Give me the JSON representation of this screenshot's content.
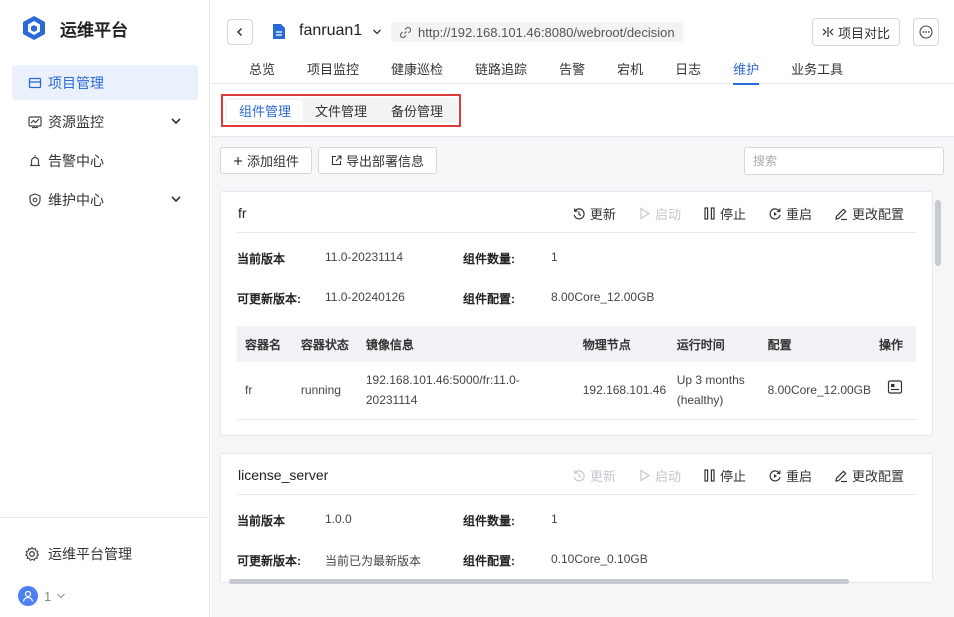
{
  "app": {
    "title": "运维平台",
    "brand_color": "#2a6ad6"
  },
  "sidebar": {
    "items": [
      {
        "label": "项目管理",
        "icon": "folder-icon",
        "active": true
      },
      {
        "label": "资源监控",
        "icon": "monitor-icon",
        "expandable": true
      },
      {
        "label": "告警中心",
        "icon": "alarm-icon"
      },
      {
        "label": "维护中心",
        "icon": "shield-icon",
        "expandable": true
      }
    ],
    "manage_label": "运维平台管理",
    "user_label": "1"
  },
  "header": {
    "project_name": "fanruan1",
    "url": "http://192.168.101.46:8080/webroot/decision",
    "compare_label": "项目对比",
    "tabs": [
      "总览",
      "项目监控",
      "健康巡检",
      "链路追踪",
      "告警",
      "宕机",
      "日志",
      "维护",
      "业务工具"
    ],
    "active_tab": "维护"
  },
  "subtabs": {
    "items": [
      "组件管理",
      "文件管理",
      "备份管理"
    ],
    "active": "组件管理"
  },
  "toolbar": {
    "add_label": "添加组件",
    "export_label": "导出部署信息",
    "search_placeholder": "搜索"
  },
  "actions_labels": {
    "update": "更新",
    "start": "启动",
    "stop": "停止",
    "restart": "重启",
    "config": "更改配置"
  },
  "field_labels": {
    "current_version": "当前版本",
    "updatable_version": "可更新版本:",
    "component_count": "组件数量:",
    "component_config": "组件配置:"
  },
  "components": [
    {
      "name": "fr",
      "current_version": "11.0-20231114",
      "updatable_version": "11.0-20240126",
      "count": "1",
      "config": "8.00Core_12.00GB",
      "table": {
        "headers": [
          "容器名",
          "容器状态",
          "镜像信息",
          "物理节点",
          "运行时间",
          "配置",
          "操作"
        ],
        "rows": [
          {
            "name": "fr",
            "status": "running",
            "image_line1": "192.168.101.46:5000/fr:11.0-",
            "image_line2": "20231114",
            "node": "192.168.101.46",
            "uptime_line1": "Up 3 months",
            "uptime_line2": "(healthy)",
            "config": "8.00Core_12.00GB"
          }
        ]
      }
    },
    {
      "name": "license_server",
      "current_version": "1.0.0",
      "updatable_version": "当前已为最新版本",
      "count": "1",
      "config": "0.10Core_0.10GB"
    }
  ]
}
